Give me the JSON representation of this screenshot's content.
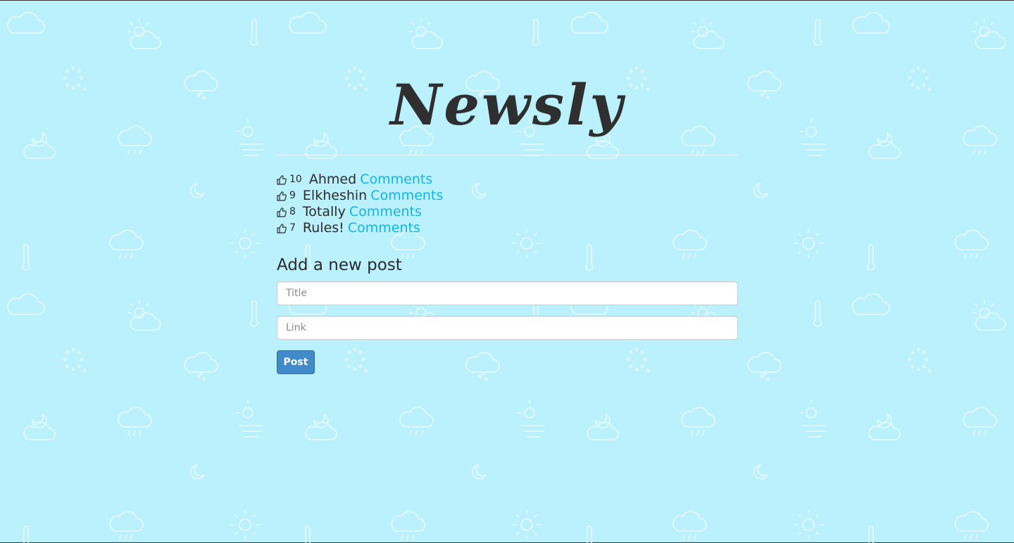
{
  "app": {
    "title": "Newsly"
  },
  "posts": [
    {
      "votes": "10",
      "title": "Ahmed",
      "comments_label": "Comments"
    },
    {
      "votes": "9",
      "title": "Elkheshin",
      "comments_label": "Comments"
    },
    {
      "votes": "8",
      "title": "Totally",
      "comments_label": "Comments"
    },
    {
      "votes": "7",
      "title": "Rules!",
      "comments_label": "Comments"
    }
  ],
  "form": {
    "heading": "Add a new post",
    "title_placeholder": "Title",
    "link_placeholder": "Link",
    "submit_label": "Post"
  },
  "icons": {
    "upvote": "thumbs-up-icon",
    "background": "weather-pattern"
  },
  "colors": {
    "background": "#bbf1fc",
    "link": "#12b3ea",
    "button": "#428bca",
    "text": "#2b2b2b"
  }
}
